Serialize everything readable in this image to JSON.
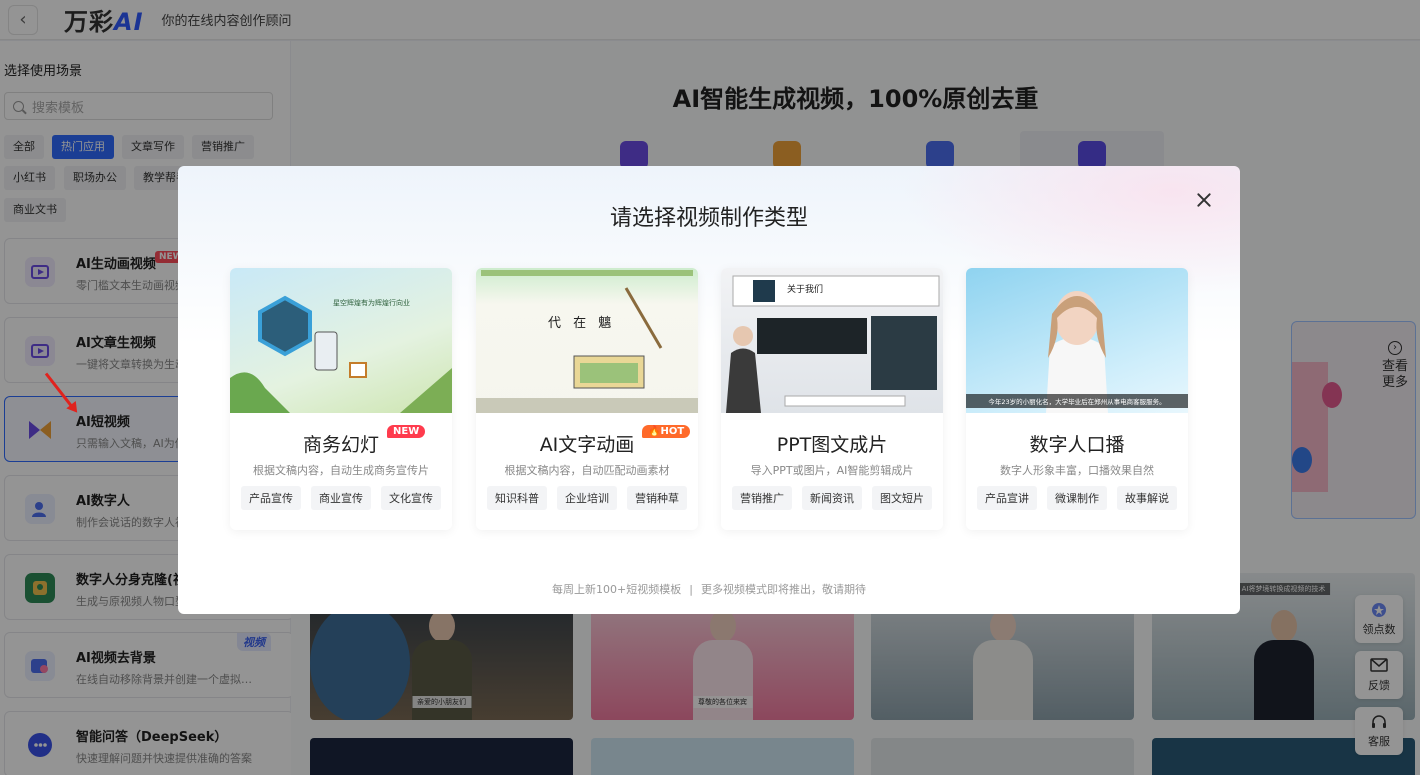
{
  "header": {
    "back_icon": "chevron-left-icon",
    "logo_text": "万彩",
    "logo_ai": "AI",
    "slogan": "你的在线内容创作顾问"
  },
  "sidebar": {
    "title": "选择使用场景",
    "search_placeholder": "搜索模板",
    "chips": [
      "全部",
      "热门应用",
      "文章写作",
      "营销推广",
      "小红书",
      "职场办公",
      "教学帮手",
      "商业文书"
    ],
    "active_chip": "热门应用",
    "items": [
      {
        "name": "AI生动画视频",
        "desc": "零门槛文本生动画视频",
        "badge": "NEW"
      },
      {
        "name": "AI文章生视频",
        "desc": "一键将文章转换为生动"
      },
      {
        "name": "AI短视频",
        "desc": "只需输入文稿，AI为你"
      },
      {
        "name": "AI数字人",
        "desc": "制作会说话的数字人视"
      },
      {
        "name": "数字人分身克隆(视",
        "desc": "生成与原视频人物口型"
      },
      {
        "name": "AI视频去背景",
        "desc": "在线自动移除背景并创建一个虚拟…",
        "badge": "视频"
      },
      {
        "name": "智能问答（DeepSeek）",
        "desc": "快速理解问题并快速提供准确的答案"
      }
    ]
  },
  "main": {
    "title": "AI智能生成视频，100%原创去重",
    "see_more": "查看更多",
    "thumb_captions": [
      "亲爱的小朋友们",
      "尊敬的各位来宾",
      "AI将梦境转换成视频的技术"
    ],
    "float_buttons": [
      "领点数",
      "反馈",
      "客服"
    ]
  },
  "modal": {
    "title": "请选择视频制作类型",
    "close_icon": "close-icon",
    "cards": [
      {
        "title": "商务幻灯",
        "desc": "根据文稿内容，自动生成商务宣传片",
        "badge": "NEW",
        "tags": [
          "产品宣传",
          "商业宣传",
          "文化宣传"
        ],
        "art_text": "星空辉煌有为辉煌行向业"
      },
      {
        "title": "AI文字动画",
        "desc": "根据文稿内容，自动匹配动画素材",
        "badge": "HOT",
        "tags": [
          "知识科普",
          "企业培训",
          "营销种草"
        ],
        "art_text": "代 在 魑"
      },
      {
        "title": "PPT图文成片",
        "desc": "导入PPT或图片，AI智能剪辑成片",
        "tags": [
          "营销推广",
          "新闻资讯",
          "图文短片"
        ],
        "art_text": "关于我们"
      },
      {
        "title": "数字人口播",
        "desc": "数字人形象丰富，口播效果自然",
        "tags": [
          "产品宣讲",
          "微课制作",
          "故事解说"
        ],
        "art_text": "今年23岁的小丽化名，大学毕业后在郑州从事电商客服服务。"
      }
    ],
    "footer_left": "每周上新100+短视频模板",
    "footer_sep": "|",
    "footer_right": "更多视频模式即将推出，敬请期待"
  },
  "colors": {
    "accent": "#2f6bff",
    "new_badge": "#ff3b4d",
    "hot_badge": "#ff6a2a",
    "annotation_arrow": "#e0231e"
  }
}
